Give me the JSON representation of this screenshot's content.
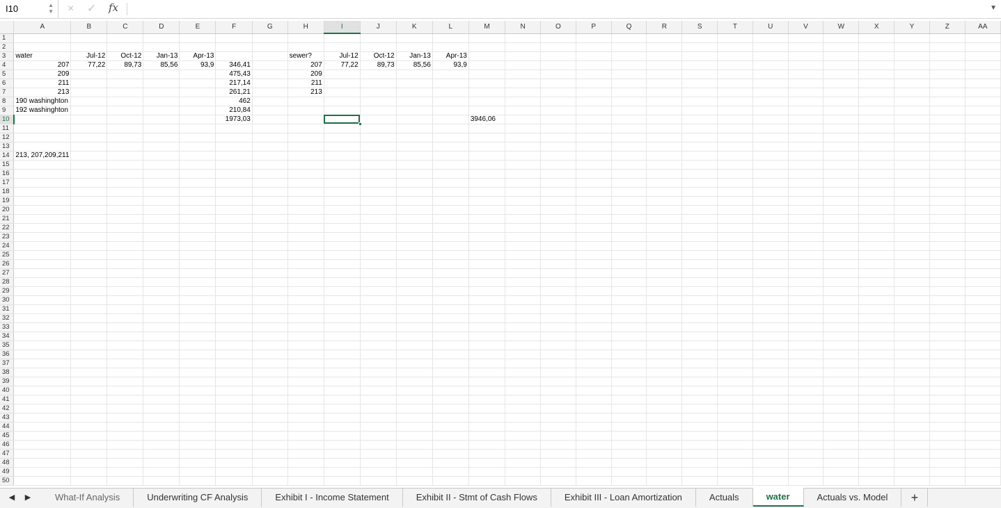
{
  "formula_bar": {
    "name_box": "I10",
    "cancel_icon": "×",
    "confirm_icon": "✓",
    "fx_label": "fx",
    "formula_value": ""
  },
  "columns": [
    "A",
    "B",
    "C",
    "D",
    "E",
    "F",
    "G",
    "H",
    "I",
    "J",
    "K",
    "L",
    "M",
    "N",
    "O",
    "P",
    "Q",
    "R",
    "S",
    "T",
    "U",
    "V",
    "W",
    "X",
    "Y",
    "Z",
    "AA"
  ],
  "active_column": "I",
  "active_row": 10,
  "row_count": 50,
  "selected_cell": "I10",
  "cells": {
    "A3": {
      "v": "water",
      "align": "left"
    },
    "B3": {
      "v": "Jul-12",
      "align": "right"
    },
    "C3": {
      "v": "Oct-12",
      "align": "right"
    },
    "D3": {
      "v": "Jan-13",
      "align": "right"
    },
    "E3": {
      "v": "Apr-13",
      "align": "right"
    },
    "H3": {
      "v": "sewer?",
      "align": "left"
    },
    "I3": {
      "v": "Jul-12",
      "align": "right"
    },
    "J3": {
      "v": "Oct-12",
      "align": "right"
    },
    "K3": {
      "v": "Jan-13",
      "align": "right"
    },
    "L3": {
      "v": "Apr-13",
      "align": "right"
    },
    "A4": {
      "v": "207",
      "align": "right"
    },
    "B4": {
      "v": "77,22",
      "align": "right"
    },
    "C4": {
      "v": "89,73",
      "align": "right"
    },
    "D4": {
      "v": "85,56",
      "align": "right"
    },
    "E4": {
      "v": "93,9",
      "align": "right"
    },
    "F4": {
      "v": "346,41",
      "align": "right"
    },
    "H4": {
      "v": "207",
      "align": "right"
    },
    "I4": {
      "v": "77,22",
      "align": "right"
    },
    "J4": {
      "v": "89,73",
      "align": "right"
    },
    "K4": {
      "v": "85,56",
      "align": "right"
    },
    "L4": {
      "v": "93,9",
      "align": "right"
    },
    "A5": {
      "v": "209",
      "align": "right"
    },
    "F5": {
      "v": "475,43",
      "align": "right"
    },
    "H5": {
      "v": "209",
      "align": "right"
    },
    "A6": {
      "v": "211",
      "align": "right"
    },
    "F6": {
      "v": "217,14",
      "align": "right"
    },
    "H6": {
      "v": "211",
      "align": "right"
    },
    "A7": {
      "v": "213",
      "align": "right"
    },
    "F7": {
      "v": "261,21",
      "align": "right"
    },
    "H7": {
      "v": "213",
      "align": "right"
    },
    "A8": {
      "v": "190 washinghton",
      "align": "left"
    },
    "F8": {
      "v": "462",
      "align": "right"
    },
    "A9": {
      "v": "192 washinghton",
      "align": "left"
    },
    "F9": {
      "v": "210,84",
      "align": "right"
    },
    "F10": {
      "v": "1973,03",
      "align": "right"
    },
    "M10": {
      "v": "3946,06",
      "align": "left"
    },
    "A14": {
      "v": "213, 207,209,211",
      "align": "left"
    }
  },
  "sheet_tabs": [
    {
      "label": "What-If Analysis",
      "active": false
    },
    {
      "label": "Underwriting CF Analysis",
      "active": false
    },
    {
      "label": "Exhibit I - Income Statement",
      "active": false
    },
    {
      "label": "Exhibit II - Stmt of Cash Flows",
      "active": false
    },
    {
      "label": "Exhibit III - Loan Amortization",
      "active": false
    },
    {
      "label": "Actuals",
      "active": false
    },
    {
      "label": "water",
      "active": true
    },
    {
      "label": "Actuals vs. Model",
      "active": false
    }
  ],
  "tab_nav": {
    "prev_icon": "◀",
    "next_icon": "▶",
    "add_icon": "+"
  },
  "accent_color": "#1e7145"
}
